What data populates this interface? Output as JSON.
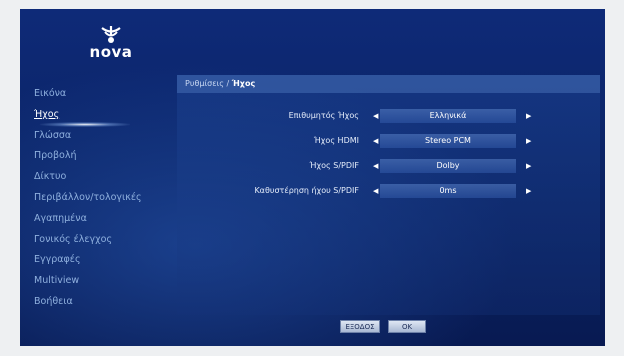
{
  "logo": {
    "word": "nova"
  },
  "sidebar": {
    "items": [
      {
        "label": "Εικόνα",
        "active": false
      },
      {
        "label": "Ήχος",
        "active": true
      },
      {
        "label": "Γλώσσα",
        "active": false
      },
      {
        "label": "Προβολή",
        "active": false
      },
      {
        "label": "Δίκτυο",
        "active": false
      },
      {
        "label": "Περιβάλλον/τολογικές",
        "active": false
      },
      {
        "label": "Αγαπημένα",
        "active": false
      },
      {
        "label": "Γονικός έλεγχος",
        "active": false
      },
      {
        "label": "Εγγραφές",
        "active": false
      },
      {
        "label": "Multiview",
        "active": false
      },
      {
        "label": "Βοήθεια",
        "active": false
      }
    ]
  },
  "breadcrumb": {
    "parent": "Ρυθμίσεις / ",
    "current": "Ήχος"
  },
  "settings": [
    {
      "label": "Επιθυμητός Ήχος",
      "value": "Ελληνικά"
    },
    {
      "label": "Ήχος HDMI",
      "value": "Stereo PCM"
    },
    {
      "label": "Ήχος S/PDIF",
      "value": "Dolby"
    },
    {
      "label": "Καθυστέρηση ήχου S/PDIF",
      "value": "0ms"
    }
  ],
  "buttons": {
    "exit": "ΕΞΟΔΟΣ",
    "ok": "OK"
  },
  "colors": {
    "background": "#0b2466",
    "sidebar_text": "#8fb0de",
    "active_text": "#ffffff"
  }
}
